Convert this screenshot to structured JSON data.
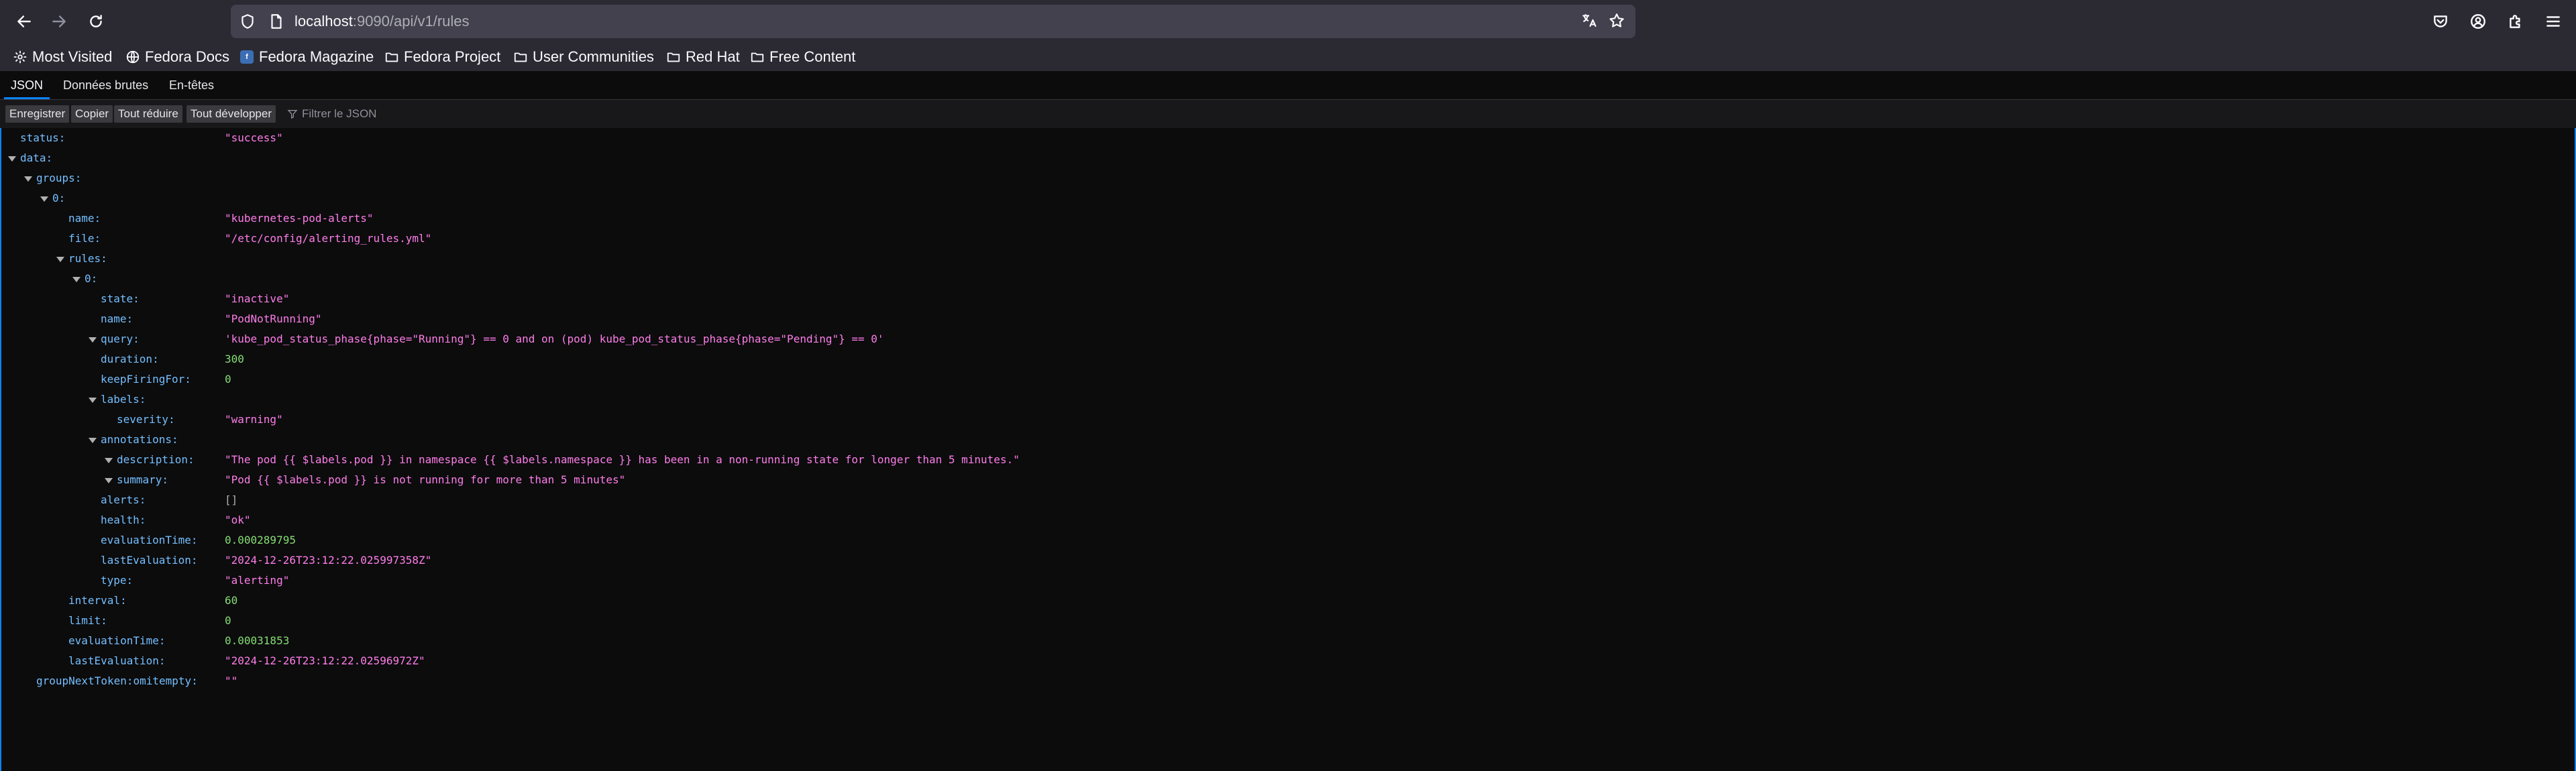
{
  "browser": {
    "url_host": "localhost",
    "url_rest": ":9090/api/v1/rules",
    "icons": [
      "back-arrow-icon",
      "forward-arrow-icon",
      "reload-icon",
      "shield-icon",
      "page-icon",
      "translate-icon",
      "star-icon",
      "pocket-icon",
      "account-icon",
      "extensions-icon",
      "menu-icon"
    ]
  },
  "bookmarks": [
    {
      "label": "Most Visited",
      "icon": "gear-icon"
    },
    {
      "label": "Fedora Docs",
      "icon": "globe-icon"
    },
    {
      "label": "Fedora Magazine",
      "icon": "fedora-icon"
    },
    {
      "label": "Fedora Project",
      "icon": "folder-icon"
    },
    {
      "label": "User Communities",
      "icon": "folder-icon"
    },
    {
      "label": "Red Hat",
      "icon": "folder-icon"
    },
    {
      "label": "Free Content",
      "icon": "folder-icon"
    }
  ],
  "viewer": {
    "tabs": [
      "JSON",
      "Données brutes",
      "En-têtes"
    ],
    "toolbar": [
      "Enregistrer",
      "Copier",
      "Tout réduire",
      "Tout développer"
    ],
    "filter_placeholder": "Filtrer le JSON"
  },
  "json_rows": [
    {
      "key": "status:",
      "value": "\"success\"",
      "type": "str",
      "depth": 0,
      "twisty": false
    },
    {
      "key": "data:",
      "value": "",
      "type": "",
      "depth": 0,
      "twisty": true
    },
    {
      "key": "groups:",
      "value": "",
      "type": "",
      "depth": 1,
      "twisty": true
    },
    {
      "key": "0:",
      "value": "",
      "type": "",
      "depth": 2,
      "twisty": true
    },
    {
      "key": "name:",
      "value": "\"kubernetes-pod-alerts\"",
      "type": "str",
      "depth": 3,
      "twisty": false
    },
    {
      "key": "file:",
      "value": "\"/etc/config/alerting_rules.yml\"",
      "type": "str",
      "depth": 3,
      "twisty": false
    },
    {
      "key": "rules:",
      "value": "",
      "type": "",
      "depth": 3,
      "twisty": true
    },
    {
      "key": "0:",
      "value": "",
      "type": "",
      "depth": 4,
      "twisty": true
    },
    {
      "key": "state:",
      "value": "\"inactive\"",
      "type": "str",
      "depth": 5,
      "twisty": false
    },
    {
      "key": "name:",
      "value": "\"PodNotRunning\"",
      "type": "str",
      "depth": 5,
      "twisty": false
    },
    {
      "key": "query:",
      "value": "'kube_pod_status_phase{phase=\"Running\"} == 0 and on (pod) kube_pod_status_phase{phase=\"Pending\"} == 0'",
      "type": "str",
      "depth": 5,
      "twisty": true
    },
    {
      "key": "duration:",
      "value": "300",
      "type": "num",
      "depth": 5,
      "twisty": false
    },
    {
      "key": "keepFiringFor:",
      "value": "0",
      "type": "num",
      "depth": 5,
      "twisty": false
    },
    {
      "key": "labels:",
      "value": "",
      "type": "",
      "depth": 5,
      "twisty": true
    },
    {
      "key": "severity:",
      "value": "\"warning\"",
      "type": "str",
      "depth": 6,
      "twisty": false
    },
    {
      "key": "annotations:",
      "value": "",
      "type": "",
      "depth": 5,
      "twisty": true
    },
    {
      "key": "description:",
      "value": "\"The pod {{ $labels.pod }} in namespace {{ $labels.namespace }} has been in a non-running state for longer than 5 minutes.\"",
      "type": "str",
      "depth": 6,
      "twisty": true
    },
    {
      "key": "summary:",
      "value": "\"Pod {{ $labels.pod }} is not running for more than 5 minutes\"",
      "type": "str",
      "depth": 6,
      "twisty": true
    },
    {
      "key": "alerts:",
      "value": "[]",
      "type": "plain",
      "depth": 5,
      "twisty": false
    },
    {
      "key": "health:",
      "value": "\"ok\"",
      "type": "str",
      "depth": 5,
      "twisty": false
    },
    {
      "key": "evaluationTime:",
      "value": "0.000289795",
      "type": "num",
      "depth": 5,
      "twisty": false
    },
    {
      "key": "lastEvaluation:",
      "value": "\"2024-12-26T23:12:22.025997358Z\"",
      "type": "str",
      "depth": 5,
      "twisty": false
    },
    {
      "key": "type:",
      "value": "\"alerting\"",
      "type": "str",
      "depth": 5,
      "twisty": false
    },
    {
      "key": "interval:",
      "value": "60",
      "type": "num",
      "depth": 3,
      "twisty": false
    },
    {
      "key": "limit:",
      "value": "0",
      "type": "num",
      "depth": 3,
      "twisty": false
    },
    {
      "key": "evaluationTime:",
      "value": "0.00031853",
      "type": "num",
      "depth": 3,
      "twisty": false
    },
    {
      "key": "lastEvaluation:",
      "value": "\"2024-12-26T23:12:22.02596972Z\"",
      "type": "str",
      "depth": 3,
      "twisty": false
    },
    {
      "key": "groupNextToken:omitempty:",
      "value": "\"\"",
      "type": "str",
      "depth": 1,
      "twisty": false
    }
  ]
}
